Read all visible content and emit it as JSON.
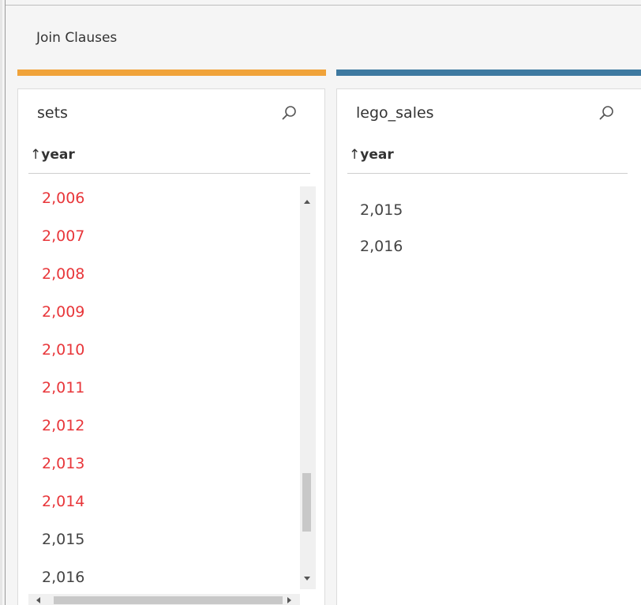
{
  "header": {
    "title": "Join Clauses"
  },
  "colors": {
    "left_accent": "#f0a33a",
    "right_accent": "#3e79a0",
    "unmatched_value": "#e8363a",
    "matched_value": "#444444"
  },
  "left_panel": {
    "title": "sets",
    "search_icon": "search-icon",
    "field": {
      "sort_arrow": "↑",
      "name": "year"
    },
    "values": [
      {
        "text": "2,006",
        "status": "unmatched"
      },
      {
        "text": "2,007",
        "status": "unmatched"
      },
      {
        "text": "2,008",
        "status": "unmatched"
      },
      {
        "text": "2,009",
        "status": "unmatched"
      },
      {
        "text": "2,010",
        "status": "unmatched"
      },
      {
        "text": "2,011",
        "status": "unmatched"
      },
      {
        "text": "2,012",
        "status": "unmatched"
      },
      {
        "text": "2,013",
        "status": "unmatched"
      },
      {
        "text": "2,014",
        "status": "unmatched"
      },
      {
        "text": "2,015",
        "status": "matched"
      },
      {
        "text": "2,016",
        "status": "matched"
      }
    ],
    "scroll_position": 0.85
  },
  "right_panel": {
    "title": "lego_sales",
    "search_icon": "search-icon",
    "field": {
      "sort_arrow": "↑",
      "name": "year"
    },
    "values": [
      {
        "text": "2,015",
        "status": "matched"
      },
      {
        "text": "2,016",
        "status": "matched"
      }
    ]
  }
}
